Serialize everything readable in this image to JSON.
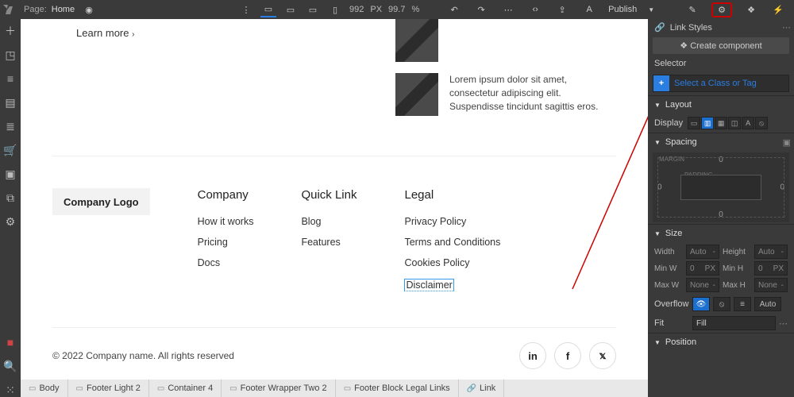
{
  "topbar": {
    "page_label": "Page:",
    "page_name": "Home",
    "canvas_width": "992",
    "px": "PX",
    "zoom": "99.7",
    "pct": "%",
    "publish": "Publish"
  },
  "left_tools": [
    "add",
    "box",
    "layers",
    "page",
    "db",
    "cart",
    "tag",
    "copy",
    "gear"
  ],
  "content": {
    "learn_more": "Learn more",
    "card1_text": "",
    "card2_text": "Lorem ipsum dolor sit amet, consectetur adipiscing elit. Suspendisse tincidunt sagittis eros.",
    "footer": {
      "logo": "Company Logo",
      "cols": [
        {
          "title": "Company",
          "links": [
            "How it works",
            "Pricing",
            "Docs"
          ]
        },
        {
          "title": "Quick Link",
          "links": [
            "Blog",
            "Features"
          ]
        },
        {
          "title": "Legal",
          "links": [
            "Privacy Policy",
            "Terms and Conditions",
            "Cookies Policy",
            "Disclaimer"
          ]
        }
      ],
      "copyright": "© 2022 Company name. All rights reserved"
    }
  },
  "breadcrumbs": [
    "Body",
    "Footer Light 2",
    "Container 4",
    "Footer Wrapper Two 2",
    "Footer Block Legal Links",
    "Link"
  ],
  "right": {
    "link_styles": "Link Styles",
    "create_component": "Create component",
    "selector_label": "Selector",
    "selector_ph": "Select a Class or Tag",
    "layout": "Layout",
    "display": "Display",
    "spacing": "Spacing",
    "margin": "MARGIN",
    "padding": "PADDING",
    "sp_vals": {
      "t": "0",
      "r": "0",
      "b": "0",
      "l": "0"
    },
    "size": "Size",
    "size_rows": [
      {
        "l1": "Width",
        "v1": "Auto",
        "l2": "Height",
        "v2": "Auto"
      },
      {
        "l1": "Min W",
        "v1": "0",
        "l2": "Min H",
        "v2": "0"
      },
      {
        "l1": "Max W",
        "v1": "None",
        "l2": "Max H",
        "v2": "None"
      }
    ],
    "overflow": "Overflow",
    "auto": "Auto",
    "fit": "Fit",
    "fill": "Fill",
    "position": "Position"
  }
}
